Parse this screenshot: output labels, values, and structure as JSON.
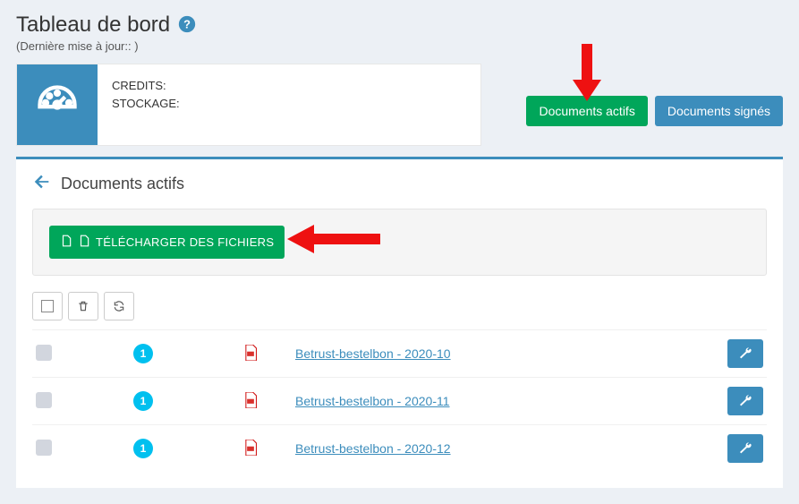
{
  "header": {
    "title": "Tableau de bord",
    "subtitle": "(Dernière mise à jour:: )"
  },
  "credits": {
    "line1": "CREDITS:",
    "line2": "STOCKAGE:"
  },
  "topButtons": {
    "active": "Documents actifs",
    "signed": "Documents signés"
  },
  "panel": {
    "title": "Documents actifs",
    "uploadLabel": "TÉLÉCHARGER DES FICHIERS"
  },
  "rows": [
    {
      "badge": "1",
      "name": "Betrust-bestelbon - 2020-10"
    },
    {
      "badge": "1",
      "name": "Betrust-bestelbon - 2020-11"
    },
    {
      "badge": "1",
      "name": "Betrust-bestelbon - 2020-12"
    }
  ]
}
